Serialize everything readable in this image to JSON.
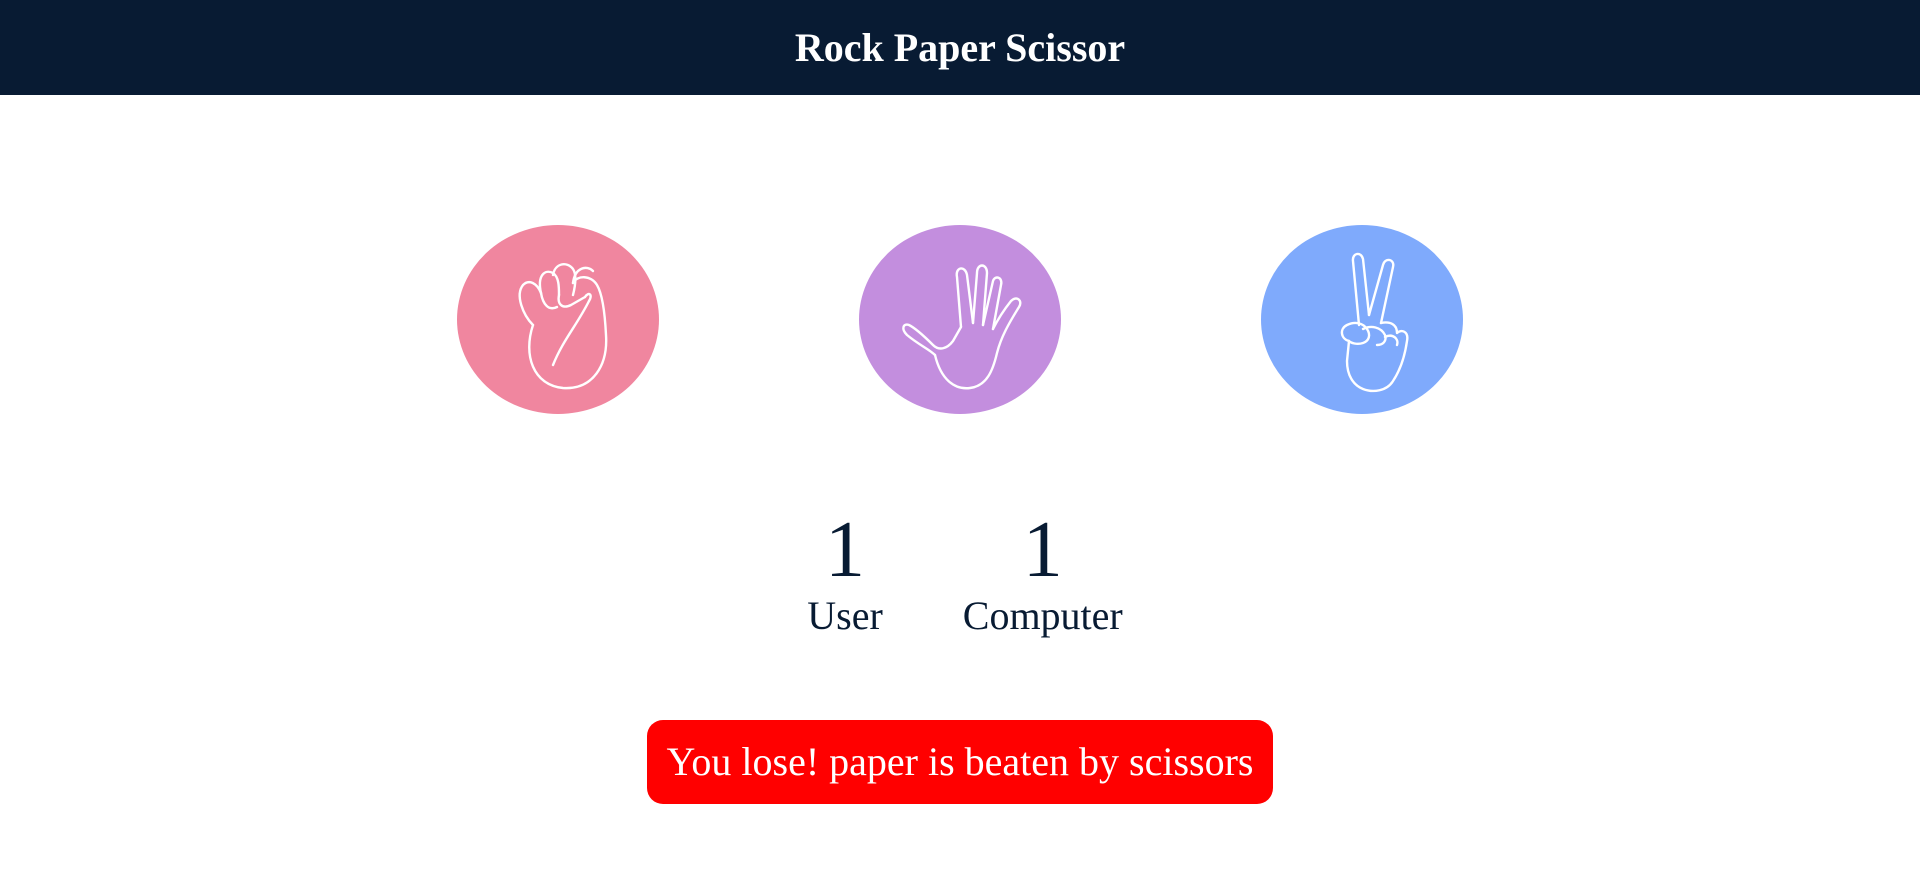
{
  "header": {
    "title": "Rock Paper Scissor"
  },
  "choices": [
    {
      "id": "rock",
      "icon": "fist-icon",
      "color": "#f0869f"
    },
    {
      "id": "paper",
      "icon": "open-hand-icon",
      "color": "#c38ede"
    },
    {
      "id": "scissors",
      "icon": "peace-hand-icon",
      "color": "#7faafc"
    }
  ],
  "score": {
    "user": {
      "value": "1",
      "label": "User"
    },
    "computer": {
      "value": "1",
      "label": "Computer"
    }
  },
  "result": {
    "message": "You lose! paper is beaten by scissors",
    "color": "#ff0000"
  }
}
